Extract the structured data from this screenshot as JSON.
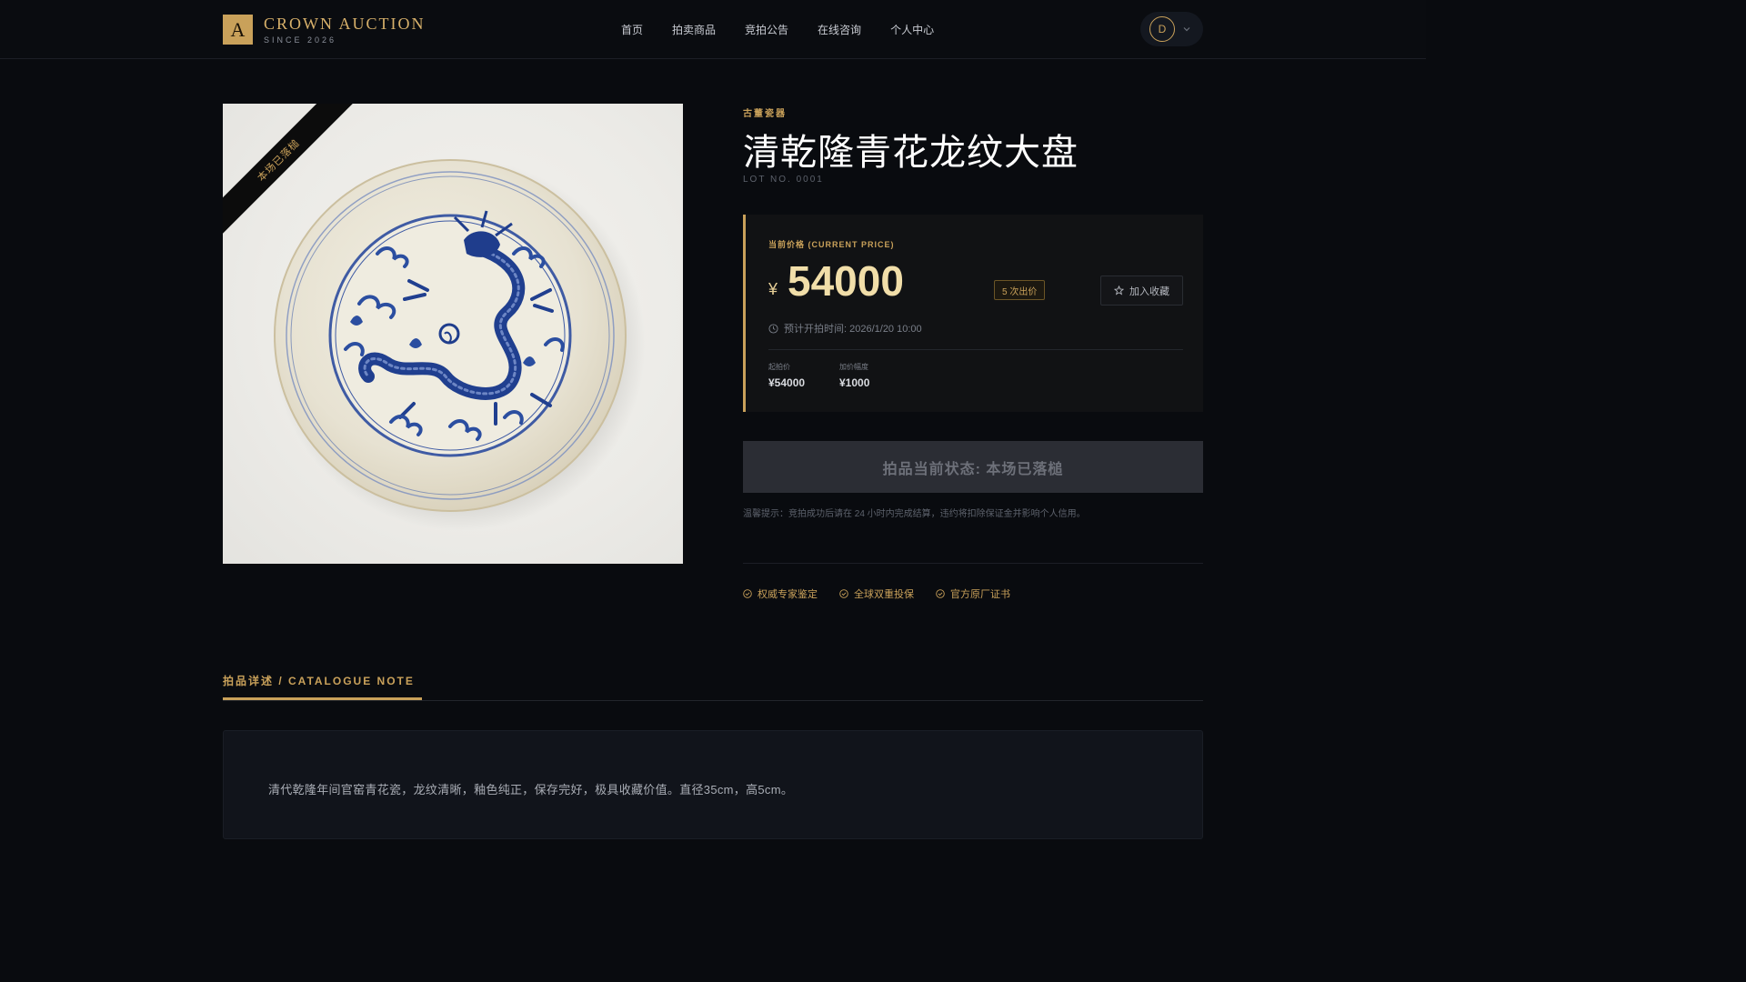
{
  "brand": {
    "mark": "A",
    "name": "CROWN AUCTION",
    "since": "SINCE 2026"
  },
  "nav": {
    "items": [
      "首页",
      "拍卖商品",
      "竞拍公告",
      "在线咨询",
      "个人中心"
    ]
  },
  "user": {
    "avatar_letter": "D"
  },
  "lot": {
    "ribbon": "本场已落槌",
    "category": "古董瓷器",
    "title": "清乾隆青花龙纹大盘",
    "lot_no": "LOT NO. 0001"
  },
  "price": {
    "label": "当前价格 (CURRENT PRICE)",
    "currency": "¥",
    "value": "54000",
    "bids_badge": "5 次出价",
    "favorite": "加入收藏",
    "time_text": "预计开拍时间: 2026/1/20 10:00",
    "start_label": "起拍价",
    "start_value": "¥54000",
    "inc_label": "加价幅度",
    "inc_value": "¥1000"
  },
  "status": {
    "text": "拍品当前状态: 本场已落槌",
    "tip": "温馨提示：竞拍成功后请在 24 小时内完成结算，违约将扣除保证金并影响个人信用。"
  },
  "guarantees": [
    "权威专家鉴定",
    "全球双重投保",
    "官方原厂证书"
  ],
  "catalogue": {
    "tab": "拍品详述 / CATALOGUE NOTE",
    "text": "清代乾隆年间官窑青花瓷，龙纹清晰，釉色纯正，保存完好，极具收藏价值。直径35cm，高5cm。"
  },
  "colors": {
    "accent": "#c9a15a",
    "background": "#090b0f",
    "price": "#f1dea9"
  }
}
